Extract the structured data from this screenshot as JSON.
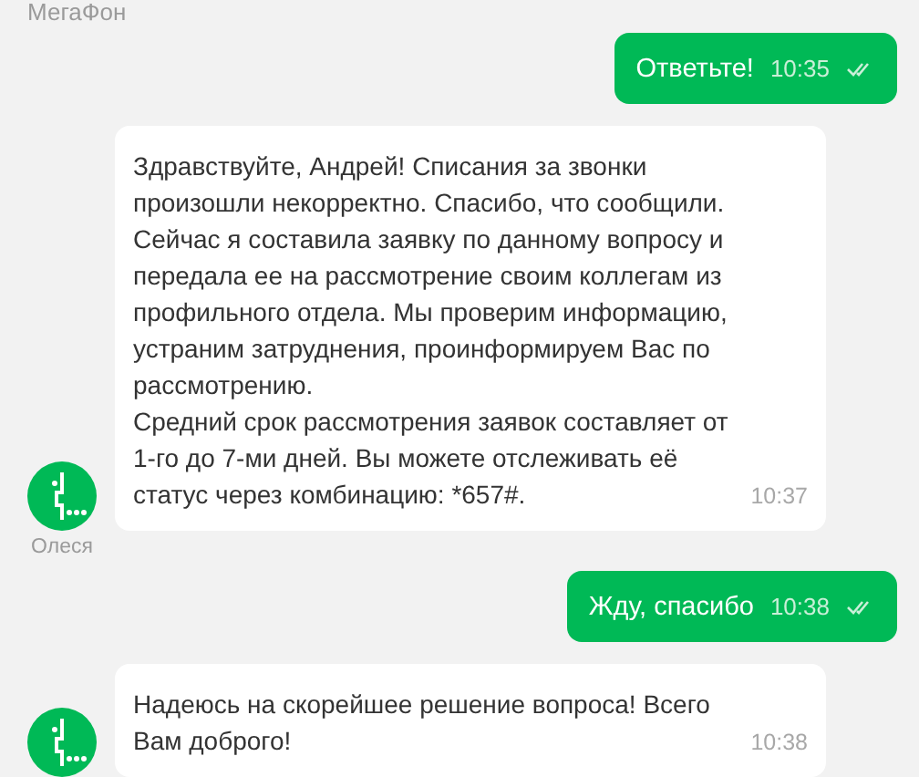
{
  "chat_title": "МегаФон",
  "messages": [
    {
      "kind": "outgoing",
      "text": "Ответьте!",
      "time": "10:35",
      "read": true
    },
    {
      "kind": "incoming",
      "text": "Здравствуйте, Андрей! Списания за звонки произошли некорректно. Спасибо, что сообщили. Сейчас я составила заявку по данному вопросу и передала ее на рассмотрение своим коллегам из профильного отдела. Мы проверим информацию, устраним затруднения, проинформируем Вас по рассмотрению.\nСредний срок рассмотрения заявок составляет от 1-го до 7-ми дней. Вы можете отслеживать её статус через комбинацию: *657#.",
      "time": "10:37",
      "sender": "Олеся"
    },
    {
      "kind": "outgoing",
      "text": "Жду, спасибо",
      "time": "10:38",
      "read": true
    },
    {
      "kind": "incoming",
      "text": "Надеюсь на скорейшее решение вопроса! Всего Вам доброго!",
      "time": "10:38"
    }
  ]
}
